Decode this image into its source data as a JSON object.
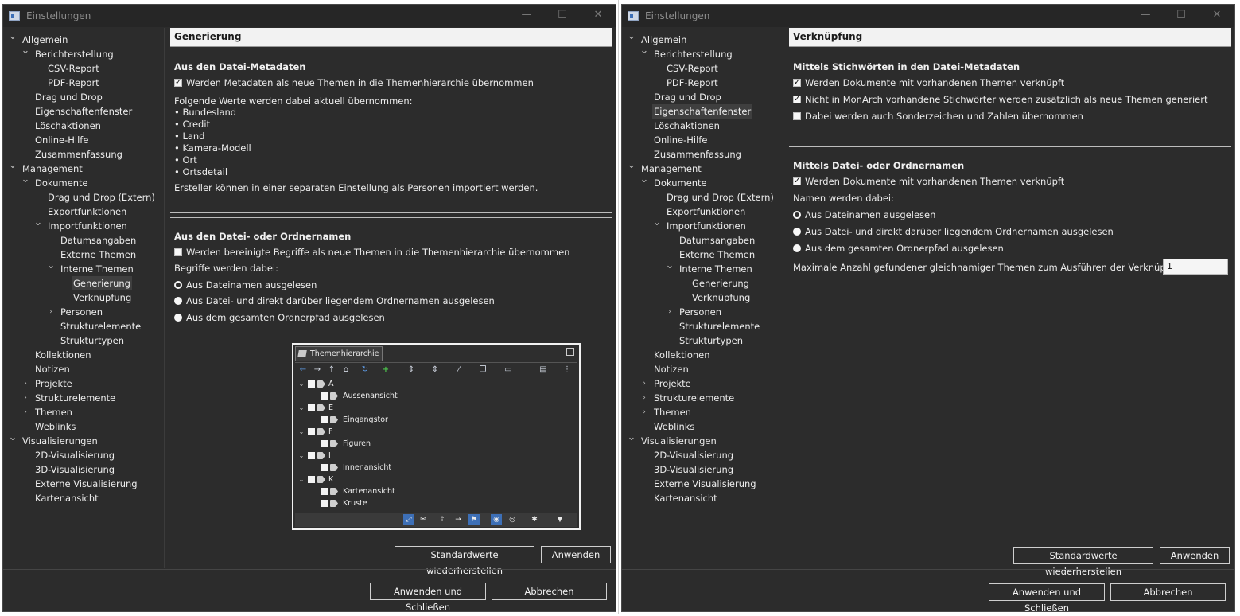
{
  "left": {
    "title": "Einstellungen",
    "header": "Generierung",
    "sections": [
      {
        "title": "Aus den Datei-Metadaten"
      },
      {
        "title": "Aus den Datei- oder Ordnernamen"
      }
    ],
    "meta_checkbox": "Werden Metadaten als neue Themen in die Themenhierarchie übernommen",
    "meta_checked": true,
    "values_label": "Folgende Werte werden dabei aktuell übernommen:",
    "values": [
      "• Bundesland",
      "• Credit",
      "• Land",
      "• Kamera-Modell",
      "• Ort",
      "• Ortsdetail"
    ],
    "creator_note": "Ersteller können in einer separaten Einstellung als Personen importiert werden.",
    "names_checkbox": "Werden bereinigte Begriffe als neue Themen in die Themenhierarchie übernommen",
    "names_checked": false,
    "terms_label": "Begriffe werden dabei:",
    "radios": [
      "Aus Dateinamen ausgelesen",
      "Aus Datei- und direkt darüber liegendem Ordnernamen ausgelesen",
      "Aus dem gesamten Ordnerpfad ausgelesen"
    ],
    "radio_selected": 0,
    "restore_label": "Standardwerte wiederherstellen",
    "apply_label": "Anwenden",
    "apply_close_label": "Anwenden und Schließen",
    "cancel_label": "Abbrechen"
  },
  "right": {
    "title": "Einstellungen",
    "header": "Verknüpfung",
    "section1": "Mittels Stichwörten in den Datei-Metadaten",
    "checks1": [
      {
        "label": "Werden Dokumente mit vorhandenen Themen verknüpft",
        "checked": true
      },
      {
        "label": "Nicht in MonArch vorhandene Stichwörter werden zusätzlich als neue Themen generiert",
        "checked": true
      },
      {
        "label": "Dabei werden auch Sonderzeichen und Zahlen übernommen",
        "checked": false
      }
    ],
    "section2": "Mittels Datei- oder Ordnernamen",
    "check2": {
      "label": "Werden Dokumente mit vorhandenen Themen verknüpft",
      "checked": true
    },
    "names_label": "Namen werden dabei:",
    "radios": [
      "Aus Dateinamen ausgelesen",
      "Aus Datei- und direkt darüber liegendem Ordnernamen ausgelesen",
      "Aus dem gesamten Ordnerpfad ausgelesen"
    ],
    "radio_selected": 0,
    "max_label": "Maximale Anzahl gefundener gleichnamiger Themen zum Ausführen der Verknüpfung:",
    "max_value": "1",
    "restore_label": "Standardwerte wiederherstellen",
    "apply_label": "Anwenden",
    "apply_close_label": "Anwenden und Schließen",
    "cancel_label": "Abbrechen"
  },
  "tree": [
    {
      "label": "Allgemein",
      "level": 0,
      "arrow": "open"
    },
    {
      "label": "Berichterstellung",
      "level": 1,
      "arrow": "open"
    },
    {
      "label": "CSV-Report",
      "level": 2,
      "arrow": ""
    },
    {
      "label": "PDF-Report",
      "level": 2,
      "arrow": ""
    },
    {
      "label": "Drag und Drop",
      "level": 1,
      "arrow": ""
    },
    {
      "label": "Eigenschaftenfenster",
      "level": 1,
      "arrow": ""
    },
    {
      "label": "Löschaktionen",
      "level": 1,
      "arrow": ""
    },
    {
      "label": "Online-Hilfe",
      "level": 1,
      "arrow": ""
    },
    {
      "label": "Zusammenfassung",
      "level": 1,
      "arrow": ""
    },
    {
      "label": "Management",
      "level": 0,
      "arrow": "open"
    },
    {
      "label": "Dokumente",
      "level": 1,
      "arrow": "open"
    },
    {
      "label": "Drag und Drop (Extern)",
      "level": 2,
      "arrow": ""
    },
    {
      "label": "Exportfunktionen",
      "level": 2,
      "arrow": ""
    },
    {
      "label": "Importfunktionen",
      "level": 2,
      "arrow": "open"
    },
    {
      "label": "Datumsangaben",
      "level": 3,
      "arrow": ""
    },
    {
      "label": "Externe Themen",
      "level": 3,
      "arrow": ""
    },
    {
      "label": "Interne Themen",
      "level": 3,
      "arrow": "open"
    },
    {
      "label": "Generierung",
      "level": 4,
      "arrow": ""
    },
    {
      "label": "Verknüpfung",
      "level": 4,
      "arrow": ""
    },
    {
      "label": "Personen",
      "level": 3,
      "arrow": "closed"
    },
    {
      "label": "Strukturelemente",
      "level": 3,
      "arrow": ""
    },
    {
      "label": "Strukturtypen",
      "level": 3,
      "arrow": ""
    },
    {
      "label": "Kollektionen",
      "level": 1,
      "arrow": ""
    },
    {
      "label": "Notizen",
      "level": 1,
      "arrow": ""
    },
    {
      "label": "Projekte",
      "level": 1,
      "arrow": "closed"
    },
    {
      "label": "Strukturelemente",
      "level": 1,
      "arrow": "closed"
    },
    {
      "label": "Themen",
      "level": 1,
      "arrow": "closed"
    },
    {
      "label": "Weblinks",
      "level": 1,
      "arrow": ""
    },
    {
      "label": "Visualisierungen",
      "level": 0,
      "arrow": "open"
    },
    {
      "label": "2D-Visualisierung",
      "level": 1,
      "arrow": ""
    },
    {
      "label": "3D-Visualisierung",
      "level": 1,
      "arrow": ""
    },
    {
      "label": "Externe Visualisierung",
      "level": 1,
      "arrow": ""
    },
    {
      "label": "Kartenansicht",
      "level": 1,
      "arrow": ""
    }
  ],
  "tree_selected_left": "Generierung",
  "tree_selected_right": "Eigenschaftenfenster",
  "popup": {
    "tab_label": "Themenhierarchie",
    "groups": [
      {
        "letter": "A",
        "children": [
          "Aussenansicht"
        ]
      },
      {
        "letter": "E",
        "children": [
          "Eingangstor"
        ]
      },
      {
        "letter": "F",
        "children": [
          "Figuren"
        ]
      },
      {
        "letter": "I",
        "children": [
          "Innenansicht"
        ]
      },
      {
        "letter": "K",
        "children": [
          "Kartenansicht",
          "Kruste"
        ]
      }
    ],
    "toolbar_icons": [
      "back-arrow-icon",
      "forward-arrow-icon",
      "up-arrow-icon",
      "home-icon",
      "refresh-icon",
      "add-icon",
      "move-icon",
      "move-alt-icon",
      "edit-icon",
      "copy-icon",
      "view-icon",
      "collapse-icon",
      "more-icon"
    ],
    "bottom_icons": [
      "link-icon",
      "filter-mail-icon",
      "upload-icon",
      "arrow-right-icon",
      "tree-icon",
      "merge-icon",
      "merge-alt-icon",
      "settings-icon",
      "funnel-icon"
    ]
  },
  "colors": {
    "window_bg": "#2c2c2c",
    "header_bg": "#f2f2f2",
    "accent": "#3d6fb6"
  }
}
